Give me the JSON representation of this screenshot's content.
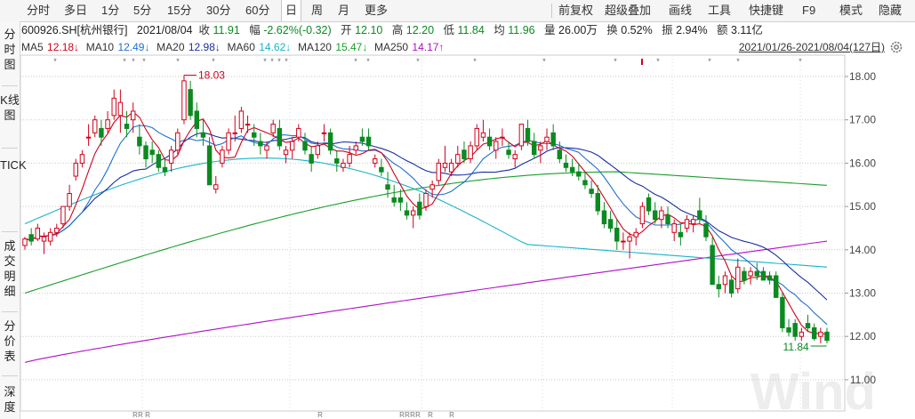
{
  "toolbar": {
    "left_items": [
      "分时",
      "多日",
      "1分",
      "5分",
      "15分",
      "30分",
      "60分",
      "日",
      "周",
      "月",
      "更多"
    ],
    "active": "日",
    "right_items": [
      "前复权",
      "超级叠加",
      "画线",
      "工具",
      "快捷键",
      "F9",
      "模式",
      "隐藏"
    ]
  },
  "sidebar": {
    "items": [
      "分时图",
      "K线图",
      "TICK",
      "成交明细",
      "分价表",
      "深度"
    ]
  },
  "info": {
    "code": "600926.SH[杭州银行]",
    "date": "2021/08/04",
    "close_label": "收",
    "close": "11.91",
    "change_label": "幅",
    "change": "-2.62%(-0.32)",
    "open_label": "开",
    "open": "12.10",
    "high_label": "高",
    "high": "12.20",
    "low_label": "低",
    "low": "11.84",
    "avg_label": "均",
    "avg": "11.96",
    "volume_label": "量",
    "volume": "26.00万",
    "turnover_label": "换",
    "turnover": "0.52%",
    "amplitude_label": "振",
    "amplitude": "2.94%",
    "amount_label": "额",
    "amount": "3.11亿"
  },
  "ma": [
    {
      "label": "MA5",
      "value": "12.18↓",
      "color": "#d0021b"
    },
    {
      "label": "MA10",
      "value": "12.49↓",
      "color": "#1f6fd0"
    },
    {
      "label": "MA20",
      "value": "12.98↓",
      "color": "#1a2fa0"
    },
    {
      "label": "MA60",
      "value": "14.62↓",
      "color": "#18b4c8"
    },
    {
      "label": "MA120",
      "value": "15.47↓",
      "color": "#1a9e2a"
    },
    {
      "label": "MA250",
      "value": "14.17↑",
      "color": "#b010c8"
    }
  ],
  "range_label": "2021/01/26-2021/08/04(127日)",
  "colors": {
    "up": "#d0021b",
    "down": "#0a8a20",
    "ma5": "#d0021b",
    "ma10": "#1f6fd0",
    "ma20": "#1a2fa0",
    "ma60": "#18b4c8",
    "ma120": "#1a9e2a",
    "ma250": "#b010c8"
  },
  "watermark": "Wind",
  "chart_data": {
    "type": "candlestick",
    "period": "2021/01/26-2021/08/04",
    "ylim": [
      11,
      18
    ],
    "yticks": [
      "18.00",
      "17.00",
      "16.00",
      "15.00",
      "14.00",
      "13.00",
      "12.00",
      "11.00"
    ],
    "annotations": {
      "high": "18.03",
      "low": "11.84"
    },
    "candles": [
      {
        "o": 14.1,
        "h": 14.3,
        "l": 14.0,
        "c": 14.25
      },
      {
        "o": 14.35,
        "h": 14.5,
        "l": 14.1,
        "c": 14.2
      },
      {
        "o": 14.25,
        "h": 14.6,
        "l": 14.2,
        "c": 14.5
      },
      {
        "o": 14.2,
        "h": 14.4,
        "l": 13.9,
        "c": 14.3
      },
      {
        "o": 14.2,
        "h": 14.5,
        "l": 14.1,
        "c": 14.4
      },
      {
        "o": 14.4,
        "h": 14.6,
        "l": 14.3,
        "c": 14.5
      },
      {
        "o": 14.6,
        "h": 15.0,
        "l": 14.5,
        "c": 15.0
      },
      {
        "o": 15.0,
        "h": 15.5,
        "l": 14.9,
        "c": 15.3
      },
      {
        "o": 15.7,
        "h": 16.1,
        "l": 15.6,
        "c": 16.0
      },
      {
        "o": 16.0,
        "h": 16.3,
        "l": 15.9,
        "c": 16.2
      },
      {
        "o": 16.6,
        "h": 16.9,
        "l": 16.4,
        "c": 16.6
      },
      {
        "o": 16.7,
        "h": 17.1,
        "l": 16.6,
        "c": 17.0
      },
      {
        "o": 16.8,
        "h": 17.0,
        "l": 16.4,
        "c": 16.6
      },
      {
        "o": 16.8,
        "h": 17.2,
        "l": 16.7,
        "c": 17.0
      },
      {
        "o": 17.1,
        "h": 17.7,
        "l": 17.0,
        "c": 17.5
      },
      {
        "o": 17.1,
        "h": 17.7,
        "l": 16.7,
        "c": 17.4
      },
      {
        "o": 16.9,
        "h": 17.2,
        "l": 16.6,
        "c": 16.8
      },
      {
        "o": 17.0,
        "h": 17.4,
        "l": 16.7,
        "c": 17.2
      },
      {
        "o": 16.6,
        "h": 16.9,
        "l": 16.2,
        "c": 16.4
      },
      {
        "o": 16.4,
        "h": 16.5,
        "l": 15.9,
        "c": 16.1
      },
      {
        "o": 16.3,
        "h": 16.5,
        "l": 16.0,
        "c": 16.2
      },
      {
        "o": 16.2,
        "h": 16.3,
        "l": 15.8,
        "c": 15.9
      },
      {
        "o": 15.9,
        "h": 16.1,
        "l": 15.7,
        "c": 15.8
      },
      {
        "o": 16.0,
        "h": 16.4,
        "l": 15.8,
        "c": 16.3
      },
      {
        "o": 16.3,
        "h": 16.8,
        "l": 16.2,
        "c": 16.7
      },
      {
        "o": 17.0,
        "h": 18.03,
        "l": 16.9,
        "c": 17.9
      },
      {
        "o": 17.7,
        "h": 17.9,
        "l": 17.0,
        "c": 17.1
      },
      {
        "o": 17.2,
        "h": 17.4,
        "l": 16.6,
        "c": 16.8
      },
      {
        "o": 16.7,
        "h": 17.0,
        "l": 16.4,
        "c": 16.6
      },
      {
        "o": 16.4,
        "h": 16.6,
        "l": 15.5,
        "c": 15.5
      },
      {
        "o": 15.4,
        "h": 15.7,
        "l": 15.3,
        "c": 15.5
      },
      {
        "o": 16.0,
        "h": 16.4,
        "l": 15.9,
        "c": 16.3
      },
      {
        "o": 16.3,
        "h": 16.8,
        "l": 16.2,
        "c": 16.7
      },
      {
        "o": 16.7,
        "h": 17.1,
        "l": 16.5,
        "c": 16.7
      },
      {
        "o": 16.8,
        "h": 17.3,
        "l": 16.7,
        "c": 17.2
      },
      {
        "o": 16.9,
        "h": 17.1,
        "l": 16.7,
        "c": 16.9
      },
      {
        "o": 16.7,
        "h": 16.9,
        "l": 16.4,
        "c": 16.6
      },
      {
        "o": 16.5,
        "h": 16.7,
        "l": 16.2,
        "c": 16.4
      },
      {
        "o": 16.3,
        "h": 16.5,
        "l": 16.1,
        "c": 16.4
      },
      {
        "o": 16.7,
        "h": 17.0,
        "l": 16.6,
        "c": 16.9
      },
      {
        "o": 16.8,
        "h": 17.0,
        "l": 16.3,
        "c": 16.4
      },
      {
        "o": 16.2,
        "h": 16.4,
        "l": 16.0,
        "c": 16.3
      },
      {
        "o": 16.3,
        "h": 16.6,
        "l": 16.1,
        "c": 16.5
      },
      {
        "o": 16.6,
        "h": 16.9,
        "l": 16.5,
        "c": 16.8
      },
      {
        "o": 16.5,
        "h": 16.7,
        "l": 16.2,
        "c": 16.3
      },
      {
        "o": 16.2,
        "h": 16.4,
        "l": 15.8,
        "c": 16.0
      },
      {
        "o": 16.2,
        "h": 16.5,
        "l": 16.1,
        "c": 16.4
      },
      {
        "o": 16.7,
        "h": 16.9,
        "l": 16.5,
        "c": 16.7
      },
      {
        "o": 16.7,
        "h": 16.8,
        "l": 16.2,
        "c": 16.3
      },
      {
        "o": 16.1,
        "h": 16.3,
        "l": 15.8,
        "c": 16.0
      },
      {
        "o": 15.9,
        "h": 16.1,
        "l": 15.8,
        "c": 16.0
      },
      {
        "o": 16.0,
        "h": 16.4,
        "l": 15.9,
        "c": 16.2
      },
      {
        "o": 16.3,
        "h": 16.5,
        "l": 16.2,
        "c": 16.4
      },
      {
        "o": 16.6,
        "h": 16.8,
        "l": 16.4,
        "c": 16.5
      },
      {
        "o": 16.6,
        "h": 16.8,
        "l": 16.3,
        "c": 16.4
      },
      {
        "o": 16.0,
        "h": 16.2,
        "l": 15.9,
        "c": 16.1
      },
      {
        "o": 15.9,
        "h": 16.1,
        "l": 15.7,
        "c": 15.8
      },
      {
        "o": 15.5,
        "h": 15.8,
        "l": 15.2,
        "c": 15.4
      },
      {
        "o": 15.2,
        "h": 15.5,
        "l": 15.0,
        "c": 15.1
      },
      {
        "o": 15.2,
        "h": 15.4,
        "l": 14.9,
        "c": 15.1
      },
      {
        "o": 14.9,
        "h": 15.1,
        "l": 14.7,
        "c": 14.8
      },
      {
        "o": 14.8,
        "h": 15.0,
        "l": 14.5,
        "c": 14.9
      },
      {
        "o": 15.1,
        "h": 15.3,
        "l": 14.7,
        "c": 14.8
      },
      {
        "o": 15.0,
        "h": 15.4,
        "l": 14.9,
        "c": 15.3
      },
      {
        "o": 15.4,
        "h": 15.6,
        "l": 15.2,
        "c": 15.5
      },
      {
        "o": 15.6,
        "h": 16.1,
        "l": 15.5,
        "c": 16.0
      },
      {
        "o": 15.9,
        "h": 16.4,
        "l": 15.8,
        "c": 16.0
      },
      {
        "o": 15.8,
        "h": 16.1,
        "l": 15.7,
        "c": 16.0
      },
      {
        "o": 16.0,
        "h": 16.4,
        "l": 15.9,
        "c": 16.2
      },
      {
        "o": 16.3,
        "h": 16.5,
        "l": 16.0,
        "c": 16.1
      },
      {
        "o": 16.1,
        "h": 16.5,
        "l": 16.0,
        "c": 16.4
      },
      {
        "o": 16.4,
        "h": 16.9,
        "l": 16.3,
        "c": 16.8
      },
      {
        "o": 16.6,
        "h": 17.0,
        "l": 16.5,
        "c": 16.7
      },
      {
        "o": 16.6,
        "h": 16.8,
        "l": 16.3,
        "c": 16.4
      },
      {
        "o": 16.3,
        "h": 16.6,
        "l": 16.1,
        "c": 16.5
      },
      {
        "o": 16.6,
        "h": 16.8,
        "l": 16.4,
        "c": 16.6
      },
      {
        "o": 16.3,
        "h": 16.5,
        "l": 16.1,
        "c": 16.2
      },
      {
        "o": 16.1,
        "h": 16.3,
        "l": 15.9,
        "c": 16.2
      },
      {
        "o": 16.4,
        "h": 16.9,
        "l": 16.3,
        "c": 16.9
      },
      {
        "o": 16.8,
        "h": 17.0,
        "l": 16.4,
        "c": 16.5
      },
      {
        "o": 16.5,
        "h": 16.7,
        "l": 16.1,
        "c": 16.2
      },
      {
        "o": 16.3,
        "h": 16.5,
        "l": 16.0,
        "c": 16.4
      },
      {
        "o": 16.5,
        "h": 16.8,
        "l": 16.3,
        "c": 16.6
      },
      {
        "o": 16.7,
        "h": 16.9,
        "l": 16.3,
        "c": 16.4
      },
      {
        "o": 16.3,
        "h": 16.5,
        "l": 16.0,
        "c": 16.1
      },
      {
        "o": 16.0,
        "h": 16.2,
        "l": 15.8,
        "c": 15.9
      },
      {
        "o": 15.9,
        "h": 16.1,
        "l": 15.7,
        "c": 15.8
      },
      {
        "o": 15.8,
        "h": 16.0,
        "l": 15.6,
        "c": 15.7
      },
      {
        "o": 15.6,
        "h": 15.8,
        "l": 15.4,
        "c": 15.5
      },
      {
        "o": 15.4,
        "h": 15.6,
        "l": 15.2,
        "c": 15.3
      },
      {
        "o": 15.3,
        "h": 15.5,
        "l": 14.8,
        "c": 14.9
      },
      {
        "o": 14.9,
        "h": 15.1,
        "l": 14.5,
        "c": 14.6
      },
      {
        "o": 14.7,
        "h": 14.9,
        "l": 14.4,
        "c": 14.5
      },
      {
        "o": 14.5,
        "h": 14.7,
        "l": 14.0,
        "c": 14.2
      },
      {
        "o": 14.2,
        "h": 14.4,
        "l": 14.0,
        "c": 14.2
      },
      {
        "o": 14.2,
        "h": 14.4,
        "l": 13.8,
        "c": 14.3
      },
      {
        "o": 14.3,
        "h": 14.5,
        "l": 14.1,
        "c": 14.4
      },
      {
        "o": 14.6,
        "h": 15.1,
        "l": 14.5,
        "c": 15.0
      },
      {
        "o": 15.2,
        "h": 15.3,
        "l": 14.8,
        "c": 14.9
      },
      {
        "o": 14.9,
        "h": 15.1,
        "l": 14.6,
        "c": 14.7
      },
      {
        "o": 14.7,
        "h": 15.0,
        "l": 14.5,
        "c": 14.9
      },
      {
        "o": 14.8,
        "h": 15.0,
        "l": 14.5,
        "c": 14.6
      },
      {
        "o": 14.4,
        "h": 14.7,
        "l": 14.2,
        "c": 14.6
      },
      {
        "o": 14.4,
        "h": 14.6,
        "l": 14.1,
        "c": 14.3
      },
      {
        "o": 14.5,
        "h": 14.8,
        "l": 14.4,
        "c": 14.7
      },
      {
        "o": 14.6,
        "h": 14.8,
        "l": 14.4,
        "c": 14.7
      },
      {
        "o": 14.9,
        "h": 15.2,
        "l": 14.6,
        "c": 14.7
      },
      {
        "o": 14.6,
        "h": 14.8,
        "l": 14.2,
        "c": 14.3
      },
      {
        "o": 14.1,
        "h": 14.3,
        "l": 13.2,
        "c": 13.2
      },
      {
        "o": 13.2,
        "h": 13.4,
        "l": 12.9,
        "c": 13.1
      },
      {
        "o": 13.2,
        "h": 13.5,
        "l": 13.0,
        "c": 13.4
      },
      {
        "o": 13.3,
        "h": 13.4,
        "l": 12.9,
        "c": 13.0
      },
      {
        "o": 13.1,
        "h": 13.8,
        "l": 13.0,
        "c": 13.6
      },
      {
        "o": 13.5,
        "h": 13.6,
        "l": 13.2,
        "c": 13.3
      },
      {
        "o": 13.4,
        "h": 13.6,
        "l": 13.2,
        "c": 13.5
      },
      {
        "o": 13.5,
        "h": 13.7,
        "l": 13.3,
        "c": 13.4
      },
      {
        "o": 13.5,
        "h": 13.6,
        "l": 13.3,
        "c": 13.3
      },
      {
        "o": 13.4,
        "h": 13.5,
        "l": 13.2,
        "c": 13.3
      },
      {
        "o": 13.4,
        "h": 13.5,
        "l": 12.9,
        "c": 12.9
      },
      {
        "o": 12.9,
        "h": 13.0,
        "l": 12.1,
        "c": 12.2
      },
      {
        "o": 12.2,
        "h": 12.4,
        "l": 12.0,
        "c": 12.1
      },
      {
        "o": 12.3,
        "h": 12.4,
        "l": 11.9,
        "c": 12.0
      },
      {
        "o": 12.0,
        "h": 12.2,
        "l": 11.9,
        "c": 12.1
      },
      {
        "o": 12.3,
        "h": 12.5,
        "l": 12.1,
        "c": 12.2
      },
      {
        "o": 12.2,
        "h": 12.3,
        "l": 11.9,
        "c": 11.95
      },
      {
        "o": 12.0,
        "h": 12.2,
        "l": 11.84,
        "c": 12.1
      },
      {
        "o": 12.1,
        "h": 12.2,
        "l": 11.84,
        "c": 11.91
      }
    ]
  }
}
